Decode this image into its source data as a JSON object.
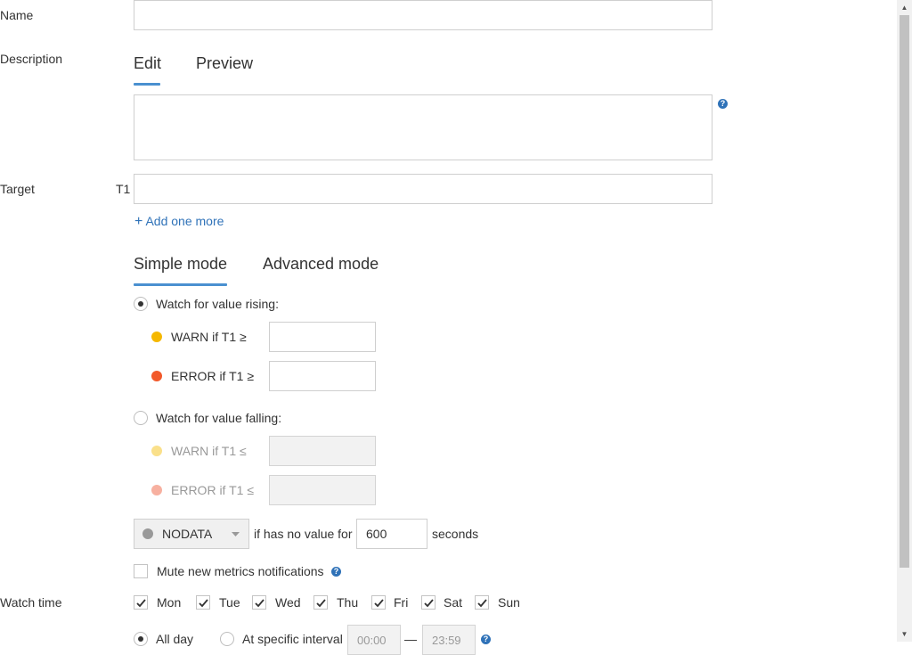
{
  "form": {
    "name": {
      "label": "Name",
      "value": ""
    },
    "description": {
      "label": "Description",
      "tabs": [
        "Edit",
        "Preview"
      ],
      "active_tab": "Edit",
      "value": "",
      "help": "?"
    },
    "target": {
      "label": "Target",
      "items": [
        {
          "prefix": "T1",
          "value": ""
        }
      ],
      "add_label": "Add one more"
    },
    "modes": {
      "tabs": [
        "Simple mode",
        "Advanced mode"
      ],
      "active": "Simple mode"
    },
    "rising": {
      "label": "Watch for value rising:",
      "selected": true,
      "warn": {
        "label": "WARN if T1 ≥",
        "value": "",
        "color": "#f5b800"
      },
      "error": {
        "label": "ERROR if T1 ≥",
        "value": "",
        "color": "#f2592a"
      }
    },
    "falling": {
      "label": "Watch for value falling:",
      "selected": false,
      "warn": {
        "label": "WARN if T1 ≤",
        "value": "",
        "color": "#fae08a"
      },
      "error": {
        "label": "ERROR if T1 ≤",
        "value": "",
        "color": "#f7b0a0"
      }
    },
    "nodata": {
      "state": "NODATA",
      "state_color": "#999999",
      "text_before": "if has no value for",
      "value": "600",
      "text_after": "seconds"
    },
    "mute": {
      "label": "Mute new metrics notifications",
      "checked": false,
      "help": "?"
    },
    "watch_time": {
      "label": "Watch time",
      "days": [
        {
          "label": "Mon",
          "checked": true
        },
        {
          "label": "Tue",
          "checked": true
        },
        {
          "label": "Wed",
          "checked": true
        },
        {
          "label": "Thu",
          "checked": true
        },
        {
          "label": "Fri",
          "checked": true
        },
        {
          "label": "Sat",
          "checked": true
        },
        {
          "label": "Sun",
          "checked": true
        }
      ],
      "all_day_label": "All day",
      "all_day_selected": true,
      "interval_label": "At specific interval",
      "interval_from": "00:00",
      "interval_separator": "—",
      "interval_to": "23:59",
      "help": "?"
    }
  },
  "colors": {
    "accent": "#4a90d0",
    "link": "#2f72b8"
  }
}
